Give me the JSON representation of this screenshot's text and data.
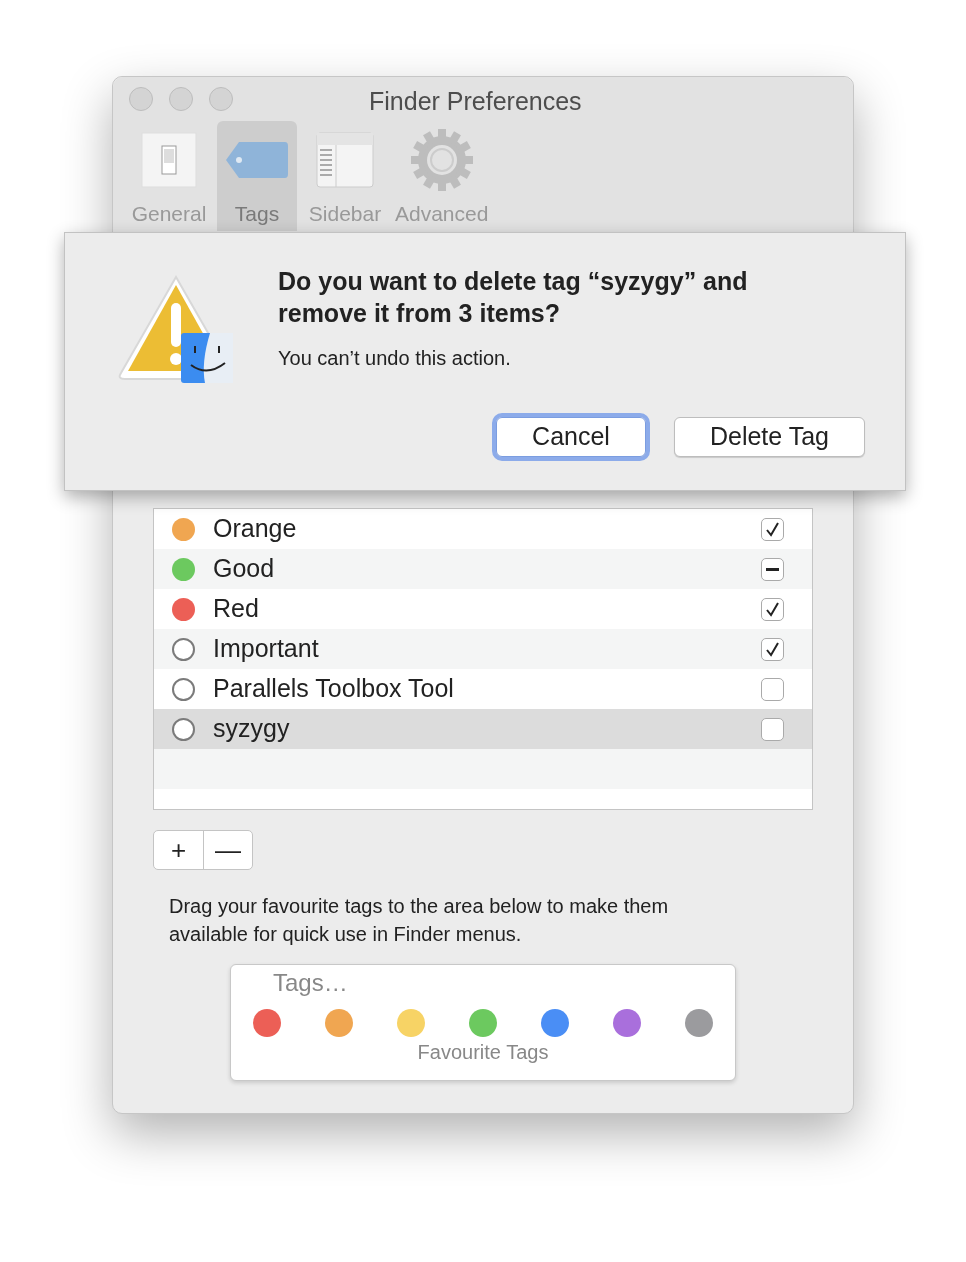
{
  "window": {
    "title": "Finder Preferences"
  },
  "tabs": [
    {
      "label": "General",
      "selected": false
    },
    {
      "label": "Tags",
      "selected": true
    },
    {
      "label": "Sidebar",
      "selected": false
    },
    {
      "label": "Advanced",
      "selected": false
    }
  ],
  "tags": [
    {
      "name": "Orange",
      "color": "#f0a651",
      "checked": true,
      "selected": false
    },
    {
      "name": "Good",
      "color": "#6cc95f",
      "mixed": true,
      "selected": false
    },
    {
      "name": "Red",
      "color": "#ec5f56",
      "checked": true,
      "selected": false
    },
    {
      "name": "Important",
      "checked": true,
      "selected": false
    },
    {
      "name": "Parallels Toolbox Tool",
      "checked": false,
      "selected": false
    },
    {
      "name": "syzygy",
      "checked": false,
      "selected": true
    }
  ],
  "list_buttons": [
    "+",
    "—"
  ],
  "hint": "Drag your favourite tags to the area below to make them available for quick use in Finder menus.",
  "favourites": {
    "item": "Tags…",
    "caption": "Favourite Tags",
    "colors": [
      {
        "color": "#ec5f56"
      },
      {
        "color": "#f0a651"
      },
      {
        "color": "#f7d365"
      },
      {
        "color": "#6cc95f"
      },
      {
        "color": "#4a8ef5"
      },
      {
        "color": "#a96fdc"
      },
      {
        "color": "#9b9b9e"
      }
    ]
  },
  "dialog": {
    "title": "Do you want to delete tag “syzygy” and remove it from 3 items?",
    "message": "You can’t undo this action.",
    "buttons": [
      {
        "label": "Cancel",
        "focused": true
      },
      {
        "label": "Delete Tag",
        "focused": false
      }
    ]
  }
}
